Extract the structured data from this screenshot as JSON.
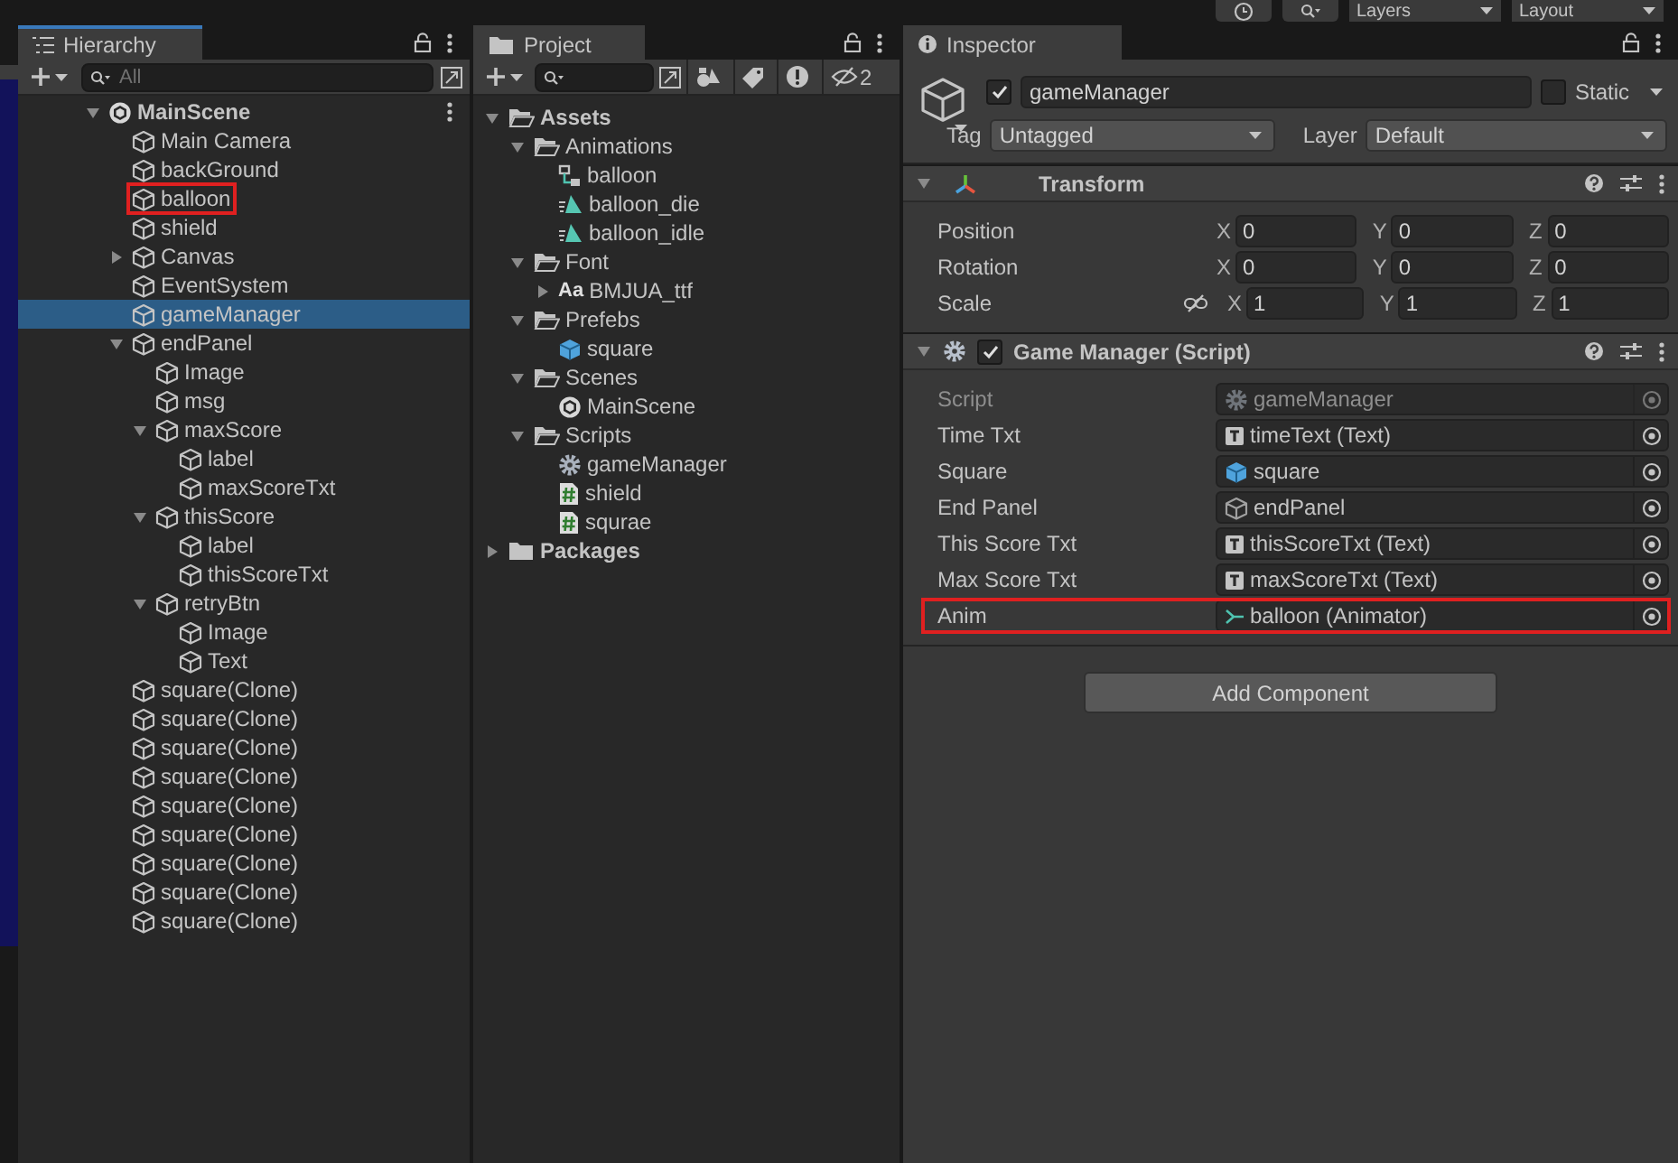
{
  "topbar": {
    "dropdowns": [
      "Layers",
      "Layout"
    ]
  },
  "hierarchy": {
    "tab": "Hierarchy",
    "search": {
      "placeholder": "All"
    },
    "items": [
      {
        "label": "MainScene",
        "kind": "scene",
        "expanded": true,
        "selected": false,
        "highlighted": false,
        "children": [
          {
            "label": "Main Camera",
            "kind": "object",
            "selected": false,
            "highlighted": false
          },
          {
            "label": "backGround",
            "kind": "object",
            "selected": false,
            "highlighted": false
          },
          {
            "label": "balloon",
            "kind": "object",
            "selected": false,
            "highlighted": true
          },
          {
            "label": "shield",
            "kind": "object",
            "selected": false,
            "highlighted": false
          },
          {
            "label": "Canvas",
            "kind": "object",
            "expanded": false,
            "selected": false,
            "highlighted": false
          },
          {
            "label": "EventSystem",
            "kind": "object",
            "selected": false,
            "highlighted": false
          },
          {
            "label": "gameManager",
            "kind": "object",
            "selected": true,
            "highlighted": false
          },
          {
            "label": "endPanel",
            "kind": "object",
            "expanded": true,
            "selected": false,
            "highlighted": false,
            "children": [
              {
                "label": "Image",
                "kind": "object",
                "selected": false,
                "highlighted": false
              },
              {
                "label": "msg",
                "kind": "object",
                "selected": false,
                "highlighted": false
              },
              {
                "label": "maxScore",
                "kind": "object",
                "expanded": true,
                "selected": false,
                "highlighted": false,
                "children": [
                  {
                    "label": "label",
                    "kind": "object",
                    "selected": false,
                    "highlighted": false
                  },
                  {
                    "label": "maxScoreTxt",
                    "kind": "object",
                    "selected": false,
                    "highlighted": false
                  }
                ]
              },
              {
                "label": "thisScore",
                "kind": "object",
                "expanded": true,
                "selected": false,
                "highlighted": false,
                "children": [
                  {
                    "label": "label",
                    "kind": "object",
                    "selected": false,
                    "highlighted": false
                  },
                  {
                    "label": "thisScoreTxt",
                    "kind": "object",
                    "selected": false,
                    "highlighted": false
                  }
                ]
              },
              {
                "label": "retryBtn",
                "kind": "object",
                "expanded": true,
                "selected": false,
                "highlighted": false,
                "children": [
                  {
                    "label": "Image",
                    "kind": "object",
                    "selected": false,
                    "highlighted": false
                  },
                  {
                    "label": "Text",
                    "kind": "object",
                    "selected": false,
                    "highlighted": false
                  }
                ]
              }
            ]
          },
          {
            "label": "square(Clone)",
            "kind": "object",
            "selected": false,
            "highlighted": false
          },
          {
            "label": "square(Clone)",
            "kind": "object",
            "selected": false,
            "highlighted": false
          },
          {
            "label": "square(Clone)",
            "kind": "object",
            "selected": false,
            "highlighted": false
          },
          {
            "label": "square(Clone)",
            "kind": "object",
            "selected": false,
            "highlighted": false
          },
          {
            "label": "square(Clone)",
            "kind": "object",
            "selected": false,
            "highlighted": false
          },
          {
            "label": "square(Clone)",
            "kind": "object",
            "selected": false,
            "highlighted": false
          },
          {
            "label": "square(Clone)",
            "kind": "object",
            "selected": false,
            "highlighted": false
          },
          {
            "label": "square(Clone)",
            "kind": "object",
            "selected": false,
            "highlighted": false
          },
          {
            "label": "square(Clone)",
            "kind": "object",
            "selected": false,
            "highlighted": false
          }
        ]
      }
    ]
  },
  "project": {
    "tab": "Project",
    "hidden_count": "2",
    "items": [
      {
        "label": "Assets",
        "kind": "folder",
        "expanded": true,
        "children": [
          {
            "label": "Animations",
            "kind": "folder",
            "expanded": true,
            "children": [
              {
                "label": "balloon",
                "kind": "animator"
              },
              {
                "label": "balloon_die",
                "kind": "clip"
              },
              {
                "label": "balloon_idle",
                "kind": "clip"
              }
            ]
          },
          {
            "label": "Font",
            "kind": "folder",
            "expanded": true,
            "children": [
              {
                "label": "BMJUA_ttf",
                "kind": "font",
                "badge": "Aa",
                "expanded": false
              }
            ]
          },
          {
            "label": "Prefebs",
            "kind": "folder",
            "expanded": true,
            "children": [
              {
                "label": "square",
                "kind": "prefab"
              }
            ]
          },
          {
            "label": "Scenes",
            "kind": "folder",
            "expanded": true,
            "children": [
              {
                "label": "MainScene",
                "kind": "scene"
              }
            ]
          },
          {
            "label": "Scripts",
            "kind": "folder",
            "expanded": true,
            "children": [
              {
                "label": "gameManager",
                "kind": "gear"
              },
              {
                "label": "shield",
                "kind": "script"
              },
              {
                "label": "squrae",
                "kind": "script"
              }
            ]
          }
        ]
      },
      {
        "label": "Packages",
        "kind": "folder",
        "expanded": false
      }
    ]
  },
  "inspector": {
    "tab": "Inspector",
    "object": {
      "active": true,
      "name": "gameManager",
      "static": false,
      "static_label": "Static",
      "tag_label": "Tag",
      "tag": "Untagged",
      "layer_label": "Layer",
      "layer": "Default"
    },
    "components": [
      {
        "kind": "transform",
        "title": "Transform",
        "expanded": true,
        "rows": [
          {
            "label": "Position",
            "kind": "vector",
            "axes": [
              {
                "axis": "X",
                "value": "0"
              },
              {
                "axis": "Y",
                "value": "0"
              },
              {
                "axis": "Z",
                "value": "0"
              }
            ]
          },
          {
            "label": "Rotation",
            "kind": "vector",
            "axes": [
              {
                "axis": "X",
                "value": "0"
              },
              {
                "axis": "Y",
                "value": "0"
              },
              {
                "axis": "Z",
                "value": "0"
              }
            ]
          },
          {
            "label": "Scale",
            "kind": "scale",
            "axes": [
              {
                "axis": "X",
                "value": "1"
              },
              {
                "axis": "Y",
                "value": "1"
              },
              {
                "axis": "Z",
                "value": "1"
              }
            ]
          }
        ]
      },
      {
        "kind": "script",
        "title": "Game Manager (Script)",
        "enabled": true,
        "expanded": true,
        "fields": [
          {
            "label": "Script",
            "value": "gameManager",
            "kind": "gear",
            "disabled": true,
            "highlighted": false
          },
          {
            "label": "Time Txt",
            "value": "timeText (Text)",
            "kind": "text",
            "disabled": false,
            "highlighted": false
          },
          {
            "label": "Square",
            "value": "square",
            "kind": "prefab",
            "disabled": false,
            "highlighted": false
          },
          {
            "label": "End Panel",
            "value": "endPanel",
            "kind": "object",
            "disabled": false,
            "highlighted": false
          },
          {
            "label": "This Score Txt",
            "value": "thisScoreTxt (Text)",
            "kind": "text",
            "disabled": false,
            "highlighted": false
          },
          {
            "label": "Max Score Txt",
            "value": "maxScoreTxt (Text)",
            "kind": "text",
            "disabled": false,
            "highlighted": false
          },
          {
            "label": "Anim",
            "value": "balloon (Animator)",
            "kind": "animator",
            "disabled": false,
            "highlighted": true
          }
        ]
      }
    ],
    "add_component": "Add Component"
  }
}
